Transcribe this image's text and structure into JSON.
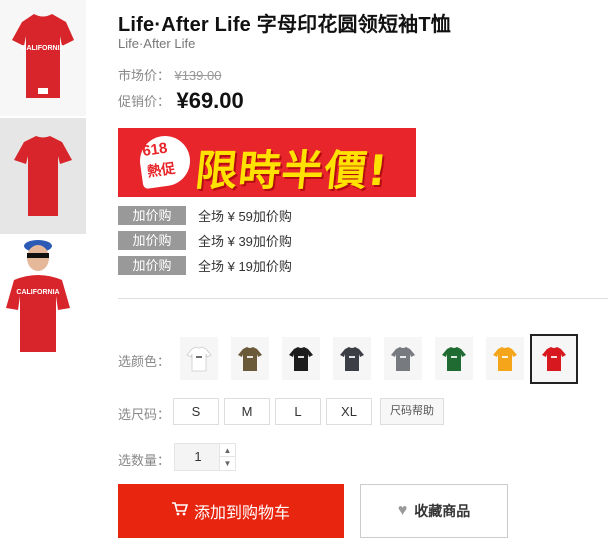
{
  "product": {
    "title": "Life·After Life 字母印花圆领短袖T恤",
    "brand": "Life·After Life"
  },
  "price": {
    "market_label": "市场价：",
    "market_value": "¥139.00",
    "promo_label": "促销价：",
    "promo_value": "¥69.00"
  },
  "banner": {
    "badge_top": "618",
    "badge_bottom": "熱促",
    "text": "限時半價!"
  },
  "addons": [
    {
      "tag": "加价购",
      "desc": "全场 ¥ 59加价购"
    },
    {
      "tag": "加价购",
      "desc": "全场 ¥ 39加价购"
    },
    {
      "tag": "加价购",
      "desc": "全场 ¥ 19加价购"
    }
  ],
  "color": {
    "label": "选颜色：",
    "options": [
      {
        "name": "white",
        "hex": "#ffffff"
      },
      {
        "name": "olive",
        "hex": "#6b5a3a"
      },
      {
        "name": "black",
        "hex": "#1d1d1d"
      },
      {
        "name": "charcoal",
        "hex": "#3b3e45"
      },
      {
        "name": "gray",
        "hex": "#777b80"
      },
      {
        "name": "green",
        "hex": "#1f6b32"
      },
      {
        "name": "yellow",
        "hex": "#f4a51a"
      },
      {
        "name": "red",
        "hex": "#d7191f"
      }
    ],
    "selected_index": 7
  },
  "size": {
    "label": "选尺码：",
    "options": [
      "S",
      "M",
      "L",
      "XL"
    ],
    "help": "尺码帮助"
  },
  "quantity": {
    "label": "选数量：",
    "value": "1"
  },
  "buttons": {
    "add_to_cart": "添加到购物车",
    "favorite": "收藏商品"
  },
  "colors": {
    "accent": "#e8250f",
    "tag_bg": "#999999"
  }
}
